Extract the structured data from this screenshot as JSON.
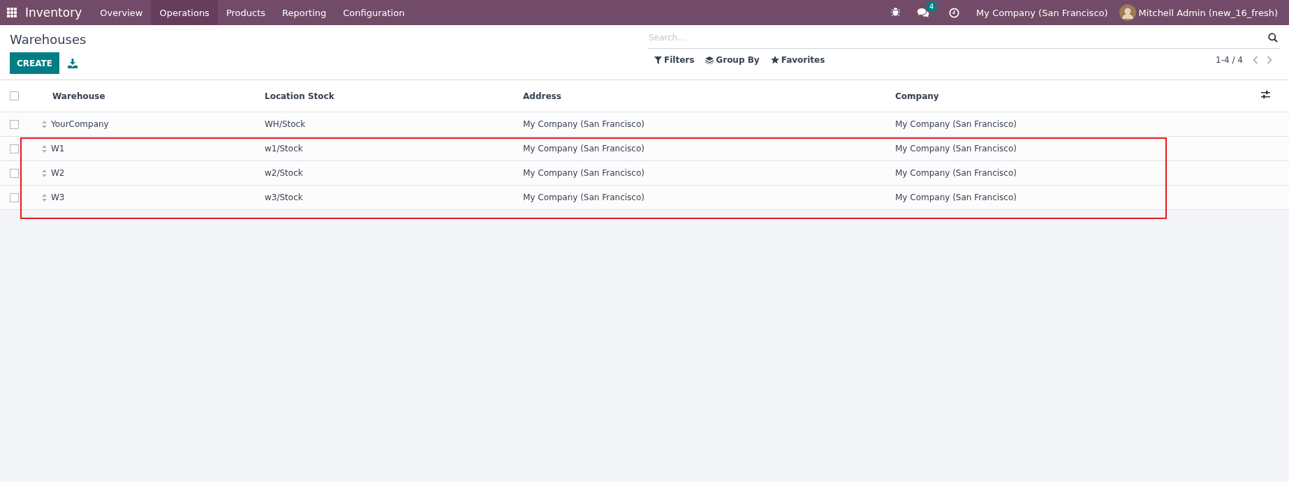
{
  "navbar": {
    "app_name": "Inventory",
    "menu": [
      {
        "label": "Overview",
        "selected": false
      },
      {
        "label": "Operations",
        "selected": true
      },
      {
        "label": "Products",
        "selected": false
      },
      {
        "label": "Reporting",
        "selected": false
      },
      {
        "label": "Configuration",
        "selected": false
      }
    ],
    "message_count": "4",
    "company": "My Company (San Francisco)",
    "user": "Mitchell Admin (new_16_fresh)"
  },
  "control_panel": {
    "title": "Warehouses",
    "create_label": "CREATE",
    "search": {
      "placeholder": "Search..."
    },
    "filters": [
      "Filters",
      "Group By",
      "Favorites"
    ],
    "pager": "1-4 / 4"
  },
  "table": {
    "all_checked": false,
    "columns": [
      "Warehouse",
      "Location Stock",
      "Address",
      "Company"
    ],
    "rows": [
      {
        "cells": [
          "YourCompany",
          "WH/Stock",
          "My Company (San Francisco)",
          "My Company (San Francisco)"
        ],
        "checked": false
      },
      {
        "cells": [
          "W1",
          "w1/Stock",
          "My Company (San Francisco)",
          "My Company (San Francisco)"
        ],
        "checked": false
      },
      {
        "cells": [
          "W2",
          "w2/Stock",
          "My Company (San Francisco)",
          "My Company (San Francisco)"
        ],
        "checked": false
      },
      {
        "cells": [
          "W3",
          "w3/Stock",
          "My Company (San Francisco)",
          "My Company (San Francisco)"
        ],
        "checked": false
      }
    ]
  }
}
